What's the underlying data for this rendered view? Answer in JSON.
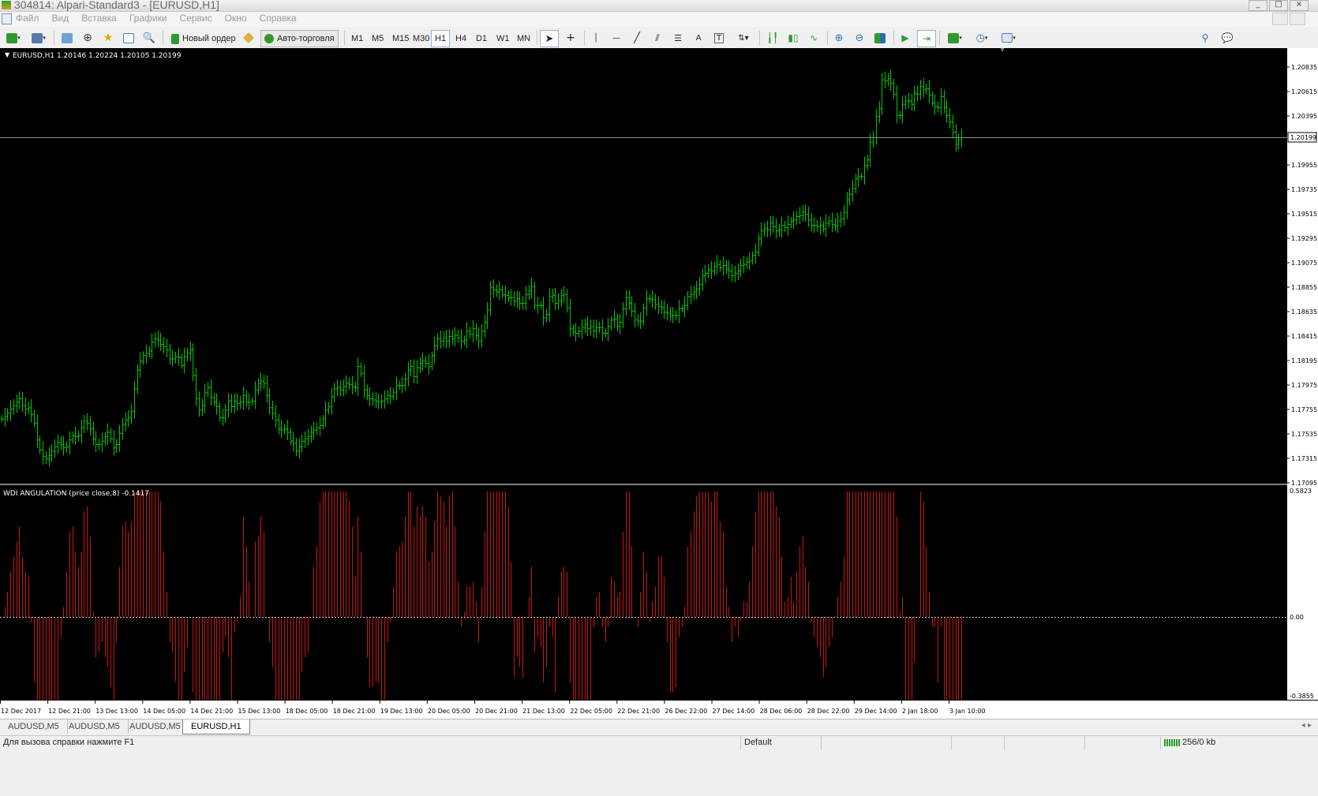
{
  "window": {
    "title": "304814: Alpari-Standard3 - [EURUSD,H1]",
    "buttons": [
      "_",
      "□",
      "×"
    ]
  },
  "menu": {
    "items": [
      "Файл",
      "Вид",
      "Вставка",
      "Графики",
      "Сервис",
      "Окно",
      "Справка"
    ]
  },
  "toolbar": {
    "new_order_label": "Новый ордер",
    "autotrading_label": "Авто-торговля",
    "timeframes": [
      "M1",
      "M5",
      "M15",
      "M30",
      "H1",
      "H4",
      "D1",
      "W1",
      "MN"
    ],
    "active_timeframe": "H1",
    "text_tool": "A",
    "label_tool": "T"
  },
  "chart": {
    "header": "EURUSD,H1  1.20146 1.20224 1.20105 1.20199",
    "current_price": "1.20199",
    "candle_color": "#00c800",
    "background": "#000000",
    "price_ticks": [
      "1.20835",
      "1.20615",
      "1.20395",
      "1.19955",
      "1.19735",
      "1.19515",
      "1.19295",
      "1.19075",
      "1.18855",
      "1.18635",
      "1.18415",
      "1.18195",
      "1.17975",
      "1.17755",
      "1.17535",
      "1.17315",
      "1.17095"
    ]
  },
  "indicator": {
    "header": "WDI ANGULATION (price close,8) -0.1417",
    "max_label": "0.5823",
    "zero_label": "0.00",
    "min_label": "-0.3855",
    "bar_color": "#c81414"
  },
  "time_axis": {
    "labels": [
      "12 Dec 2017",
      "12 Dec 21:00",
      "13 Dec 13:00",
      "14 Dec 05:00",
      "14 Dec 21:00",
      "15 Dec 13:00",
      "18 Dec 05:00",
      "18 Dec 21:00",
      "19 Dec 13:00",
      "20 Dec 05:00",
      "20 Dec 21:00",
      "21 Dec 13:00",
      "22 Dec 05:00",
      "22 Dec 21:00",
      "26 Dec 22:00",
      "27 Dec 14:00",
      "28 Dec 06:00",
      "28 Dec 22:00",
      "29 Dec 14:00",
      "2 Jan 18:00",
      "3 Jan 10:00"
    ]
  },
  "tabs": [
    {
      "label": "AUDUSD,M5",
      "active": false
    },
    {
      "label": "AUDUSD,M5",
      "active": false
    },
    {
      "label": "AUDUSD,M5",
      "active": false
    },
    {
      "label": "EURUSD,H1",
      "active": true
    }
  ],
  "status": {
    "help": "Для вызова справки нажмите F1",
    "profile": "Default",
    "traffic": "256/0 kb"
  },
  "chart_data": {
    "type": "candlestick",
    "symbol": "EURUSD",
    "timeframe": "H1",
    "ylim": [
      1.17095,
      1.20835
    ],
    "close_series": [
      1.1767,
      1.1769,
      1.1772,
      1.1776,
      1.1779,
      1.1782,
      1.1785,
      1.1779,
      1.1776,
      1.1777,
      1.1771,
      1.1763,
      1.1748,
      1.1739,
      1.1733,
      1.1731,
      1.1734,
      1.1738,
      1.1742,
      1.1746,
      1.1744,
      1.1741,
      1.1742,
      1.1748,
      1.1752,
      1.1751,
      1.1752,
      1.1759,
      1.1765,
      1.1763,
      1.1758,
      1.1749,
      1.1744,
      1.1744,
      1.1747,
      1.1751,
      1.1755,
      1.1749,
      1.1741,
      1.1744,
      1.1754,
      1.1762,
      1.1766,
      1.1768,
      1.1774,
      1.1794,
      1.1811,
      1.1819,
      1.1824,
      1.1826,
      1.1828,
      1.1836,
      1.1839,
      1.1838,
      1.1834,
      1.1832,
      1.1829,
      1.1821,
      1.1821,
      1.1823,
      1.1822,
      1.1815,
      1.1823,
      1.1826,
      1.1829,
      1.1806,
      1.1785,
      1.1775,
      1.1779,
      1.1791,
      1.1795,
      1.1786,
      1.1782,
      1.1778,
      1.1768,
      1.1768,
      1.1775,
      1.1783,
      1.1778,
      1.1783,
      1.1781,
      1.1782,
      1.1788,
      1.1782,
      1.1782,
      1.1783,
      1.1793,
      1.1799,
      1.1801,
      1.1799,
      1.1788,
      1.1777,
      1.1772,
      1.1766,
      1.1758,
      1.1757,
      1.1758,
      1.1755,
      1.1747,
      1.1745,
      1.1738,
      1.1742,
      1.1747,
      1.1749,
      1.1751,
      1.1755,
      1.1757,
      1.1759,
      1.1761,
      1.1767,
      1.1775,
      1.1778,
      1.1787,
      1.1794,
      1.1795,
      1.1793,
      1.1796,
      1.1799,
      1.1798,
      1.1796,
      1.1795,
      1.1814,
      1.1808,
      1.1793,
      1.1788,
      1.1785,
      1.1784,
      1.1783,
      1.1782,
      1.1783,
      1.1785,
      1.1788,
      1.1787,
      1.1791,
      1.1797,
      1.1797,
      1.1797,
      1.1803,
      1.1811,
      1.1814,
      1.1805,
      1.1813,
      1.1817,
      1.1819,
      1.1817,
      1.1814,
      1.1824,
      1.1833,
      1.1839,
      1.1837,
      1.184,
      1.1837,
      1.1841,
      1.1839,
      1.1842,
      1.184,
      1.1837,
      1.1838,
      1.1846,
      1.1843,
      1.1848,
      1.1842,
      1.1837,
      1.1846,
      1.1854,
      1.1865,
      1.1885,
      1.1883,
      1.1881,
      1.1883,
      1.1879,
      1.1878,
      1.1876,
      1.1876,
      1.1873,
      1.1875,
      1.1871,
      1.1871,
      1.1879,
      1.1882,
      1.1886,
      1.1869,
      1.1869,
      1.1869,
      1.1858,
      1.1861,
      1.1877,
      1.1878,
      1.1871,
      1.1873,
      1.1878,
      1.1879,
      1.1867,
      1.1848,
      1.1845,
      1.1844,
      1.1846,
      1.1849,
      1.1852,
      1.1848,
      1.185,
      1.1846,
      1.1849,
      1.1849,
      1.1844,
      1.1844,
      1.185,
      1.1856,
      1.1857,
      1.185,
      1.1854,
      1.1866,
      1.1876,
      1.1871,
      1.1864,
      1.1856,
      1.1855,
      1.1855,
      1.1867,
      1.1875,
      1.1875,
      1.1874,
      1.187,
      1.1868,
      1.1867,
      1.1863,
      1.1862,
      1.186,
      1.186,
      1.186,
      1.1866,
      1.1866,
      1.1869,
      1.1877,
      1.1879,
      1.1881,
      1.1884,
      1.1888,
      1.1896,
      1.1898,
      1.1901,
      1.19,
      1.1904,
      1.1906,
      1.1903,
      1.1905,
      1.1902,
      1.19,
      1.1896,
      1.1898,
      1.19,
      1.1905,
      1.1906,
      1.1908,
      1.1909,
      1.1914,
      1.1917,
      1.1929,
      1.1936,
      1.1938,
      1.1937,
      1.1943,
      1.194,
      1.1936,
      1.1937,
      1.1941,
      1.1939,
      1.1942,
      1.1945,
      1.1946,
      1.1949,
      1.195,
      1.1953,
      1.1951,
      1.1946,
      1.1941,
      1.1941,
      1.194,
      1.1941,
      1.1938,
      1.1943,
      1.1945,
      1.1942,
      1.1941,
      1.1945,
      1.1947,
      1.1953,
      1.1964,
      1.1969,
      1.1974,
      1.1983,
      1.1985,
      1.1985,
      1.1995,
      1.2,
      1.2016,
      1.202,
      1.2039,
      1.2046,
      1.2072,
      1.2071,
      1.2073,
      1.2069,
      1.2059,
      1.204,
      1.204,
      1.205,
      1.2053,
      1.2053,
      1.205,
      1.206,
      1.2059,
      1.2066,
      1.2063,
      1.2064,
      1.2058,
      1.2051,
      1.2048,
      1.2047,
      1.2057,
      1.2047,
      1.204,
      1.2034,
      1.2025,
      1.2014,
      1.2018,
      1.202
    ]
  }
}
